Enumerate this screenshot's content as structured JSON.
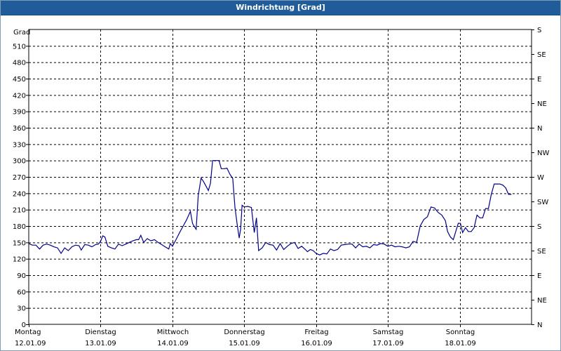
{
  "window": {
    "title": "Windrichtung [Grad]"
  },
  "colors": {
    "titlebar": "#1f5c99",
    "line": "#00008b",
    "grid": "#000000"
  },
  "chart_data": {
    "type": "line",
    "title": "Windrichtung [Grad]",
    "ylabel": "Grad",
    "ylim": [
      0,
      540
    ],
    "yticks": [
      0,
      30,
      60,
      90,
      120,
      150,
      180,
      210,
      240,
      270,
      300,
      330,
      360,
      390,
      420,
      450,
      480,
      510
    ],
    "y2_ticks": [
      {
        "value": 0,
        "label": "N"
      },
      {
        "value": 45,
        "label": "NE"
      },
      {
        "value": 90,
        "label": "E"
      },
      {
        "value": 135,
        "label": "SE"
      },
      {
        "value": 180,
        "label": "S"
      },
      {
        "value": 225,
        "label": "SW"
      },
      {
        "value": 270,
        "label": "W"
      },
      {
        "value": 315,
        "label": "NW"
      },
      {
        "value": 360,
        "label": "N"
      },
      {
        "value": 405,
        "label": "NE"
      },
      {
        "value": 450,
        "label": "E"
      },
      {
        "value": 495,
        "label": "SE"
      },
      {
        "value": 540,
        "label": "S"
      }
    ],
    "xlim": [
      0,
      7
    ],
    "x_unit": "days",
    "grid": true,
    "xticks": [
      {
        "value": 0,
        "day": "Montag",
        "date": "12.01.09"
      },
      {
        "value": 1,
        "day": "Dienstag",
        "date": "13.01.09"
      },
      {
        "value": 2,
        "day": "Mittwoch",
        "date": "14.01.09"
      },
      {
        "value": 3,
        "day": "Donnerstag",
        "date": "15.01.09"
      },
      {
        "value": 4,
        "day": "Freitag",
        "date": "16.01.09"
      },
      {
        "value": 5,
        "day": "Samstag",
        "date": "17.01.09"
      },
      {
        "value": 6,
        "day": "Sonntag",
        "date": "18.01.09"
      }
    ],
    "series": [
      {
        "points": [
          [
            0.0,
            148
          ],
          [
            0.05,
            145
          ],
          [
            0.1,
            145
          ],
          [
            0.15,
            138
          ],
          [
            0.2,
            145
          ],
          [
            0.25,
            147
          ],
          [
            0.3,
            145
          ],
          [
            0.35,
            142
          ],
          [
            0.4,
            140
          ],
          [
            0.45,
            130
          ],
          [
            0.5,
            140
          ],
          [
            0.55,
            135
          ],
          [
            0.6,
            142
          ],
          [
            0.65,
            145
          ],
          [
            0.7,
            144
          ],
          [
            0.73,
            136
          ],
          [
            0.78,
            146
          ],
          [
            0.83,
            145
          ],
          [
            0.88,
            142
          ],
          [
            0.93,
            146
          ],
          [
            0.97,
            147
          ],
          [
            1.0,
            152
          ],
          [
            1.03,
            162
          ],
          [
            1.06,
            160
          ],
          [
            1.1,
            143
          ],
          [
            1.15,
            140
          ],
          [
            1.2,
            138
          ],
          [
            1.25,
            147
          ],
          [
            1.3,
            144
          ],
          [
            1.35,
            147
          ],
          [
            1.4,
            150
          ],
          [
            1.45,
            153
          ],
          [
            1.5,
            155
          ],
          [
            1.53,
            155
          ],
          [
            1.56,
            163
          ],
          [
            1.6,
            150
          ],
          [
            1.65,
            157
          ],
          [
            1.7,
            153
          ],
          [
            1.75,
            155
          ],
          [
            1.8,
            150
          ],
          [
            1.85,
            146
          ],
          [
            1.9,
            142
          ],
          [
            1.95,
            138
          ],
          [
            1.97,
            148
          ],
          [
            2.0,
            143
          ],
          [
            2.05,
            155
          ],
          [
            2.1,
            168
          ],
          [
            2.15,
            180
          ],
          [
            2.2,
            192
          ],
          [
            2.25,
            207
          ],
          [
            2.28,
            185
          ],
          [
            2.3,
            180
          ],
          [
            2.33,
            174
          ],
          [
            2.36,
            236
          ],
          [
            2.4,
            268
          ],
          [
            2.43,
            262
          ],
          [
            2.46,
            255
          ],
          [
            2.5,
            245
          ],
          [
            2.53,
            258
          ],
          [
            2.56,
            300
          ],
          [
            2.6,
            300
          ],
          [
            2.65,
            300
          ],
          [
            2.68,
            285
          ],
          [
            2.72,
            285
          ],
          [
            2.76,
            286
          ],
          [
            2.8,
            275
          ],
          [
            2.84,
            267
          ],
          [
            2.87,
            215
          ],
          [
            2.9,
            185
          ],
          [
            2.93,
            158
          ],
          [
            2.95,
            175
          ],
          [
            2.97,
            218
          ],
          [
            3.0,
            215
          ],
          [
            3.05,
            216
          ],
          [
            3.1,
            214
          ],
          [
            3.14,
            168
          ],
          [
            3.17,
            195
          ],
          [
            3.2,
            135
          ],
          [
            3.25,
            140
          ],
          [
            3.3,
            150
          ],
          [
            3.35,
            146
          ],
          [
            3.4,
            145
          ],
          [
            3.45,
            136
          ],
          [
            3.5,
            148
          ],
          [
            3.55,
            137
          ],
          [
            3.6,
            143
          ],
          [
            3.65,
            148
          ],
          [
            3.7,
            150
          ],
          [
            3.75,
            139
          ],
          [
            3.8,
            143
          ],
          [
            3.85,
            137
          ],
          [
            3.88,
            133
          ],
          [
            3.92,
            137
          ],
          [
            3.96,
            135
          ],
          [
            4.0,
            130
          ],
          [
            4.05,
            127
          ],
          [
            4.1,
            130
          ],
          [
            4.15,
            129
          ],
          [
            4.2,
            138
          ],
          [
            4.25,
            135
          ],
          [
            4.3,
            137
          ],
          [
            4.35,
            145
          ],
          [
            4.4,
            146
          ],
          [
            4.45,
            147
          ],
          [
            4.5,
            147
          ],
          [
            4.55,
            140
          ],
          [
            4.6,
            147
          ],
          [
            4.65,
            142
          ],
          [
            4.7,
            143
          ],
          [
            4.75,
            140
          ],
          [
            4.8,
            146
          ],
          [
            4.85,
            145
          ],
          [
            4.9,
            148
          ],
          [
            4.95,
            147
          ],
          [
            5.0,
            143
          ],
          [
            5.05,
            145
          ],
          [
            5.1,
            142
          ],
          [
            5.15,
            143
          ],
          [
            5.2,
            142
          ],
          [
            5.25,
            140
          ],
          [
            5.3,
            142
          ],
          [
            5.35,
            152
          ],
          [
            5.4,
            150
          ],
          [
            5.45,
            180
          ],
          [
            5.5,
            192
          ],
          [
            5.55,
            197
          ],
          [
            5.6,
            215
          ],
          [
            5.65,
            213
          ],
          [
            5.7,
            205
          ],
          [
            5.75,
            200
          ],
          [
            5.8,
            190
          ],
          [
            5.83,
            170
          ],
          [
            5.87,
            160
          ],
          [
            5.91,
            155
          ],
          [
            5.95,
            172
          ],
          [
            5.98,
            185
          ],
          [
            6.01,
            185
          ],
          [
            6.04,
            168
          ],
          [
            6.08,
            177
          ],
          [
            6.12,
            170
          ],
          [
            6.16,
            170
          ],
          [
            6.2,
            177
          ],
          [
            6.24,
            200
          ],
          [
            6.28,
            195
          ],
          [
            6.32,
            195
          ],
          [
            6.36,
            212
          ],
          [
            6.4,
            212
          ],
          [
            6.44,
            238
          ],
          [
            6.48,
            257
          ],
          [
            6.52,
            257
          ],
          [
            6.56,
            257
          ],
          [
            6.6,
            255
          ],
          [
            6.64,
            250
          ],
          [
            6.68,
            238
          ],
          [
            6.72,
            238
          ]
        ]
      }
    ]
  }
}
